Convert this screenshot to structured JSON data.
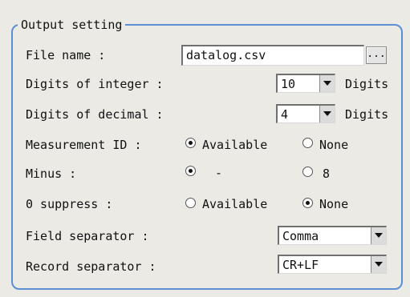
{
  "group": {
    "title": "Output setting"
  },
  "file_name": {
    "label": "File name :",
    "value": "datalog.csv",
    "browse_label": "..."
  },
  "digits_integer": {
    "label": "Digits of integer :",
    "value": "10",
    "unit": "Digits"
  },
  "digits_decimal": {
    "label": "Digits of decimal :",
    "value": "4",
    "unit": "Digits"
  },
  "measurement_id": {
    "label": "Measurement ID :",
    "options": [
      "Available",
      "None"
    ],
    "selected": "Available"
  },
  "minus": {
    "label": "Minus :",
    "options": [
      "-",
      "8"
    ],
    "selected": "-"
  },
  "zero_suppress": {
    "label": "0 suppress :",
    "options": [
      "Available",
      "None"
    ],
    "selected": "None"
  },
  "field_separator": {
    "label": "Field separator :",
    "value": "Comma"
  },
  "record_separator": {
    "label": "Record separator :",
    "value": "CR+LF"
  }
}
